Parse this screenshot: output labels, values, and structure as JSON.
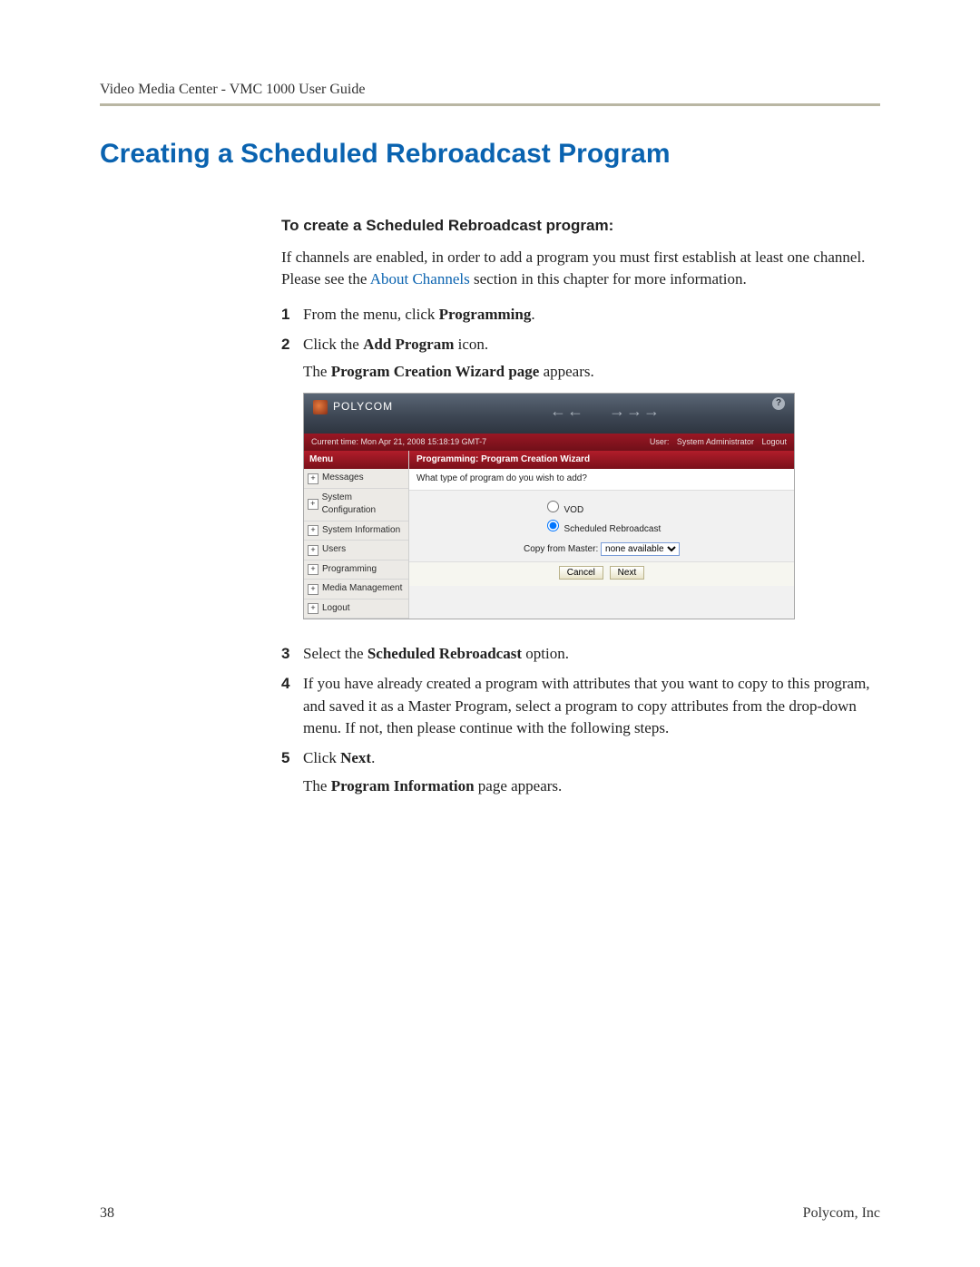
{
  "header": {
    "running_head": "Video Media Center - VMC 1000  User Guide"
  },
  "title": "Creating a Scheduled Rebroadcast Program",
  "subhead": "To create a Scheduled Rebroadcast program:",
  "intro": {
    "pre": "If channels are enabled, in order to add a program you must first establish at least one channel. Please see the ",
    "link": "About Channels",
    "post": " section in this chapter for more information."
  },
  "steps": {
    "s1": {
      "num": "1",
      "pre": "From the menu, click ",
      "bold": "Programming",
      "post": "."
    },
    "s2": {
      "num": "2",
      "pre": "Click the ",
      "bold": "Add Program",
      "post": " icon.",
      "sub_pre": "The ",
      "sub_bold": "Program Creation Wizard page",
      "sub_post": " appears."
    },
    "s3": {
      "num": "3",
      "pre": "Select the ",
      "bold": "Scheduled Rebroadcast",
      "post": " option."
    },
    "s4": {
      "num": "4",
      "text": "If you have already created a program with attributes that you want to copy to this program, and saved it as a Master Program, select a program to copy attributes from the drop-down menu. If not, then please continue with the following steps."
    },
    "s5": {
      "num": "5",
      "pre": "Click ",
      "bold": "Next",
      "post": ".",
      "sub_pre": "The ",
      "sub_bold": "Program Information",
      "sub_post": " page appears."
    }
  },
  "screenshot": {
    "brand": "POLYCOM",
    "arrows_left": "← ←",
    "arrows_right": "→ → →",
    "crumb_left": "Current time: Mon Apr 21, 2008 15:18:19 GMT-7",
    "crumb_user_label": "User:",
    "crumb_user": "System Administrator",
    "crumb_logout": "Logout",
    "menu_head": "Menu",
    "menu_items": [
      "Messages",
      "System Configuration",
      "System Information",
      "Users",
      "Programming",
      "Media Management",
      "Logout"
    ],
    "main_title": "Programming: Program Creation Wizard",
    "question": "What type of program do you wish to add?",
    "opt_vod": "VOD",
    "opt_sched": "Scheduled Rebroadcast",
    "copy_label": "Copy from Master:",
    "copy_value": "none available",
    "btn_cancel": "Cancel",
    "btn_next": "Next"
  },
  "footer": {
    "page": "38",
    "company": "Polycom, Inc"
  }
}
